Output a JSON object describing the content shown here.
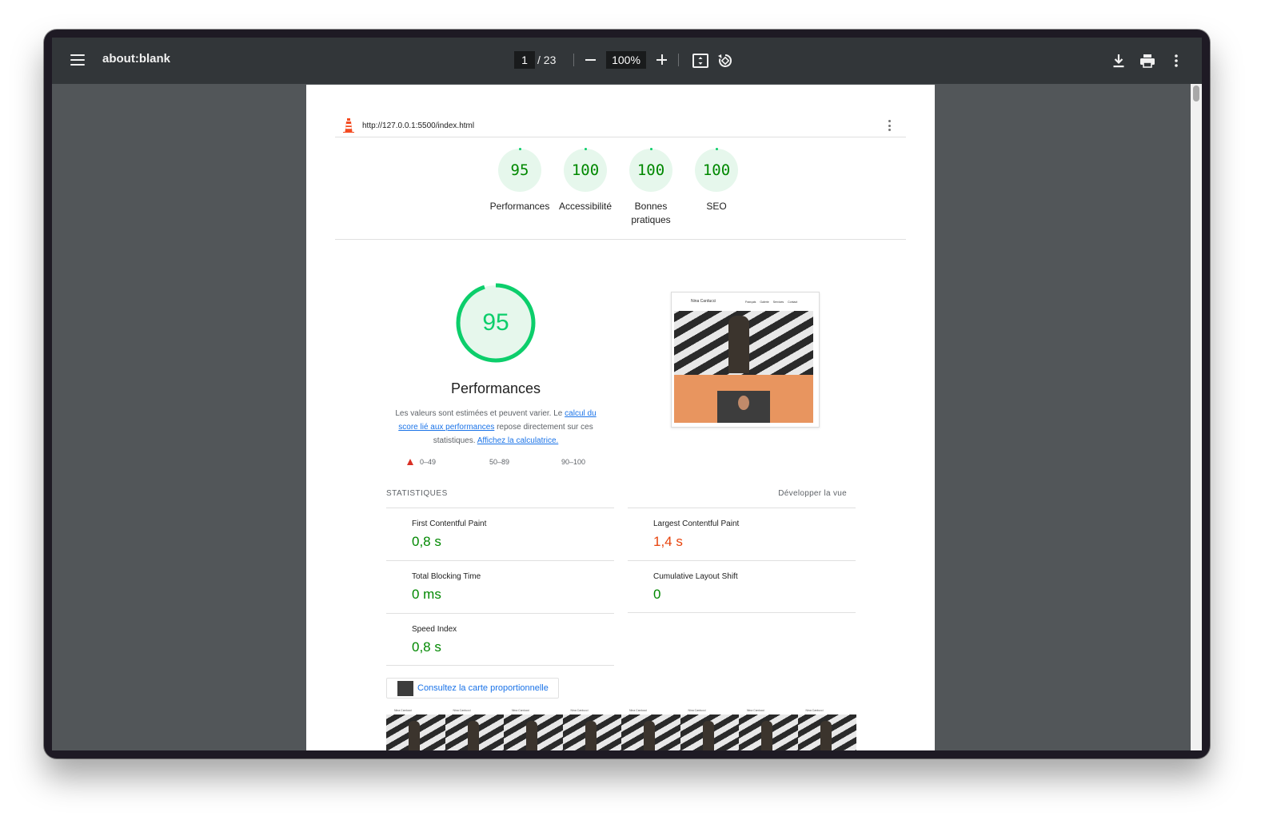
{
  "toolbar": {
    "title": "about:blank",
    "current_page": "1",
    "total_pages": "/ 23",
    "zoom": "100%",
    "icons": [
      "menu-icon",
      "zoom-out-icon",
      "zoom-in-icon",
      "fit-page-icon",
      "rotate-icon",
      "download-icon",
      "print-icon",
      "more-vert-icon"
    ]
  },
  "report": {
    "url": "http://127.0.0.1:5500/index.html",
    "gauges": [
      {
        "score": "95",
        "label": "Performances"
      },
      {
        "score": "100",
        "label": "Accessibilité"
      },
      {
        "score": "100",
        "label": "Bonnes pratiques"
      },
      {
        "score": "100",
        "label": "SEO"
      }
    ],
    "performance": {
      "score": "95",
      "score_fraction": 0.95,
      "title": "Performances",
      "desc_prefix": "Les valeurs sont estimées et peuvent varier. Le ",
      "desc_link1": "calcul du score lié aux performances",
      "desc_middle": " repose directement sur ces statistiques. ",
      "desc_link2": "Affichez la calculatrice.",
      "legend": [
        "0–49",
        "50–89",
        "90–100"
      ]
    },
    "screenshot": {
      "site_name": "Nina Carducci",
      "nav_links": [
        "Français",
        "Galerie",
        "Services",
        "Contact"
      ]
    },
    "stats": {
      "heading": "STATISTIQUES",
      "expand": "Développer la vue",
      "metrics": [
        {
          "name": "First Contentful Paint",
          "value": "0,8 s",
          "status": "pass"
        },
        {
          "name": "Largest Contentful Paint",
          "value": "1,4 s",
          "status": "average"
        },
        {
          "name": "Total Blocking Time",
          "value": "0 ms",
          "status": "pass"
        },
        {
          "name": "Cumulative Layout Shift",
          "value": "0",
          "status": "pass"
        },
        {
          "name": "Speed Index",
          "value": "0,8 s",
          "status": "pass"
        }
      ]
    },
    "treemap_label": "Consultez la carte proportionnelle",
    "filmstrip_site_name": "Nina Carducci",
    "filmstrip_frames": 8,
    "colors": {
      "pass": "#008800",
      "pass_ring": "#0cce6b",
      "pass_bg": "#e6f7ec",
      "average": "#e8430c",
      "fail": "#d93025",
      "link": "#1a73e8"
    }
  }
}
